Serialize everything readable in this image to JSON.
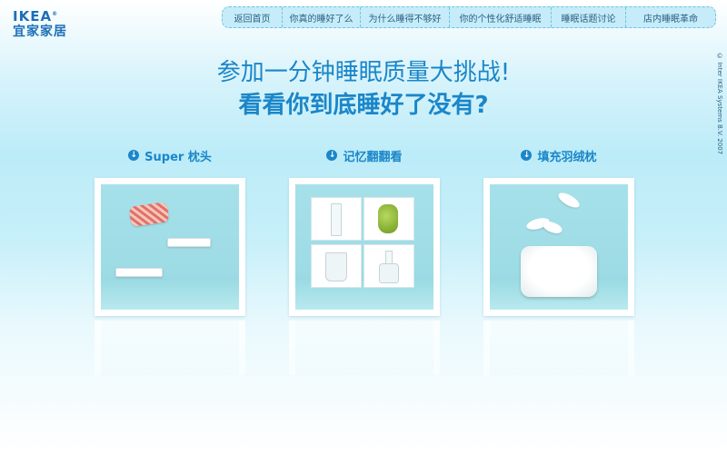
{
  "logo": {
    "brand": "IKEA",
    "reg_mark": "®",
    "chinese": "宜家家居"
  },
  "nav": {
    "items": [
      {
        "label": "返回首页"
      },
      {
        "label": "你真的睡好了么"
      },
      {
        "label": "为什么睡得不够好"
      },
      {
        "label": "你的个性化舒适睡眠"
      },
      {
        "label": "睡眠话题讨论"
      },
      {
        "label": "店内睡眠革命"
      }
    ]
  },
  "copyright": "© Inter IKEA Systems B.V. 2007",
  "headline": {
    "line1": "参加一分钟睡眠质量大挑战!",
    "line2": "看看你到底睡好了没有?"
  },
  "games": [
    {
      "label": "Super 枕头",
      "icon": "down-arrow-icon"
    },
    {
      "label": "记忆翻翻看",
      "icon": "down-arrow-icon"
    },
    {
      "label": "填充羽绒枕",
      "icon": "down-arrow-icon"
    }
  ],
  "colors": {
    "accent": "#1b86c9",
    "nav_bg": "#c5ecf8",
    "card_bg": "#a6e1ea"
  }
}
